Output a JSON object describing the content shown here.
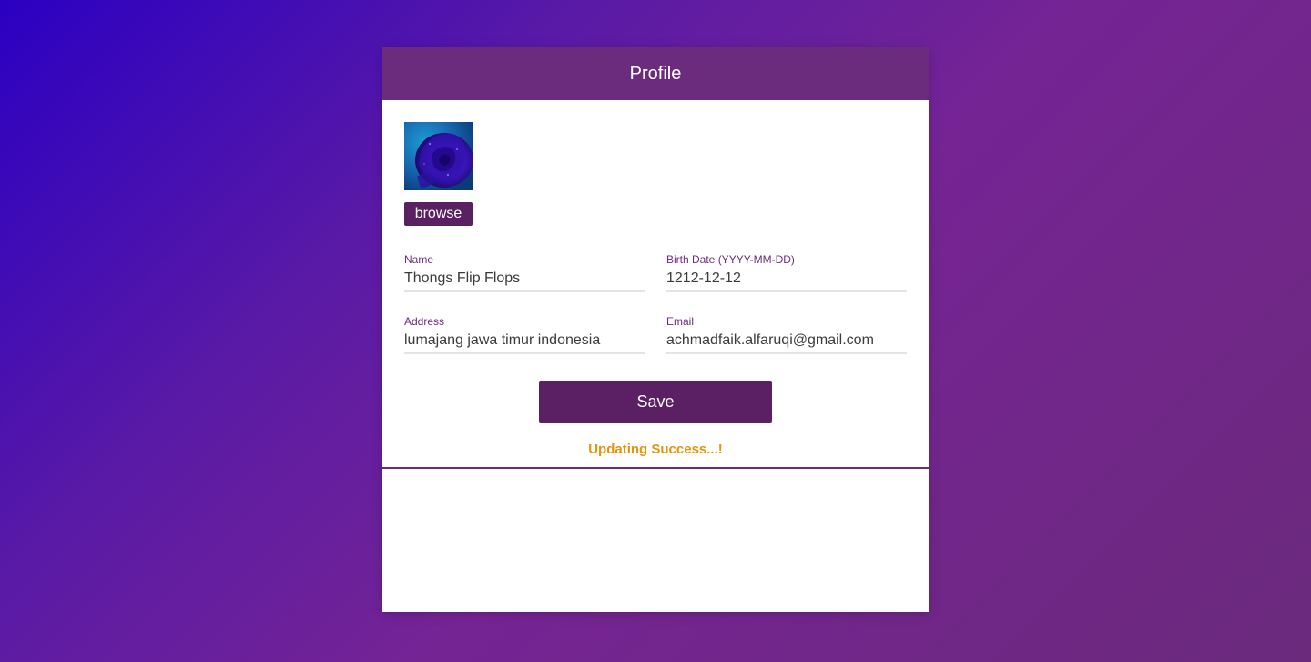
{
  "header": {
    "title": "Profile"
  },
  "avatar": {
    "icon": "rose-photo"
  },
  "browse": {
    "label": "browse"
  },
  "form": {
    "name": {
      "label": "Name",
      "value": "Thongs Flip Flops"
    },
    "birth_date": {
      "label": "Birth Date (YYYY-MM-DD)",
      "value": "1212-12-12"
    },
    "address": {
      "label": "Address",
      "value": "lumajang jawa timur indonesia"
    },
    "email": {
      "label": "Email",
      "value": "achmadfaik.alfaruqi@gmail.com"
    }
  },
  "save": {
    "label": "Save"
  },
  "status": {
    "message": "Updating Success...!"
  },
  "colors": {
    "primary": "#6c2c7d",
    "button": "#5b1f63",
    "status": "#e4940c"
  }
}
